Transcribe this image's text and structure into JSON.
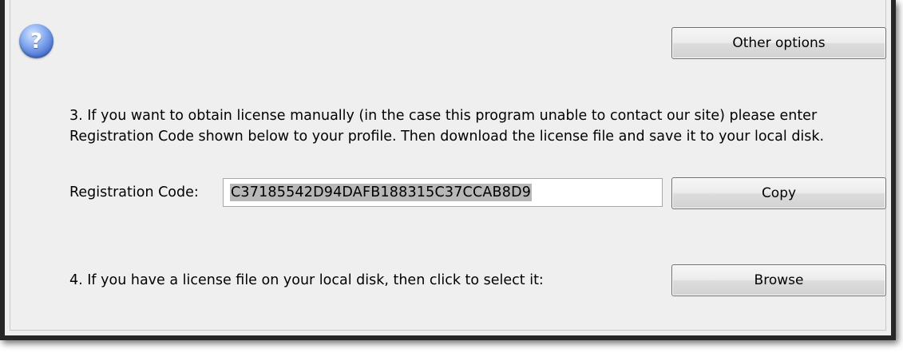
{
  "dialog": {
    "other_options_label": "Other options",
    "step3_text": "3. If you want to obtain license manually (in the case this program unable to contact our site) please enter Registration Code shown below to your profile. Then download the license file and save it to your local disk.",
    "registration_label": "Registration Code:",
    "registration_code": "C37185542D94DAFB188315C37CCAB8D9",
    "copy_label": "Copy",
    "step4_text": "4. If you have a license file on your local disk, then click to select it:",
    "browse_label": "Browse",
    "help_glyph": "?",
    "icons": {
      "help": "help-icon"
    }
  }
}
